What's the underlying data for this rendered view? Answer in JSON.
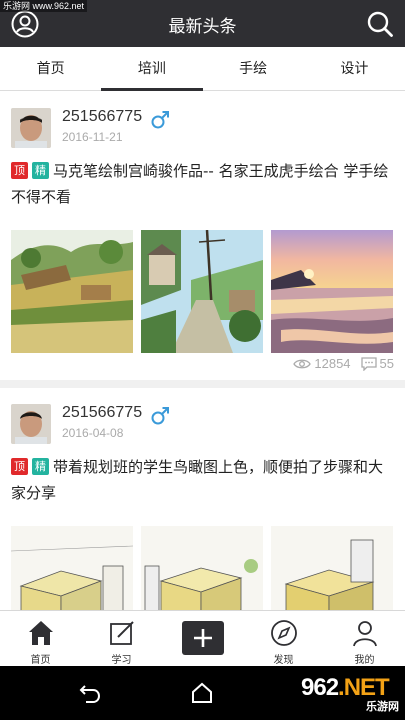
{
  "watermark": "乐游网 www.962.net",
  "header": {
    "title": "最新头条",
    "user_icon": "user-circle-icon",
    "search_icon": "search-icon"
  },
  "tabs": [
    {
      "label": "首页",
      "active": false
    },
    {
      "label": "培训",
      "active": true
    },
    {
      "label": "手绘",
      "active": false
    },
    {
      "label": "设计",
      "active": false
    }
  ],
  "posts": [
    {
      "username": "251566775",
      "date": "2016-11-21",
      "gender": "male",
      "badge_top": "顶",
      "badge_jing": "精",
      "title": "马克笔绘制宫崎骏作品-- 名家王成虎手绘合 学手绘不得不看",
      "views": "12854",
      "comments": "55"
    },
    {
      "username": "251566775",
      "date": "2016-04-08",
      "gender": "male",
      "badge_top": "顶",
      "badge_jing": "精",
      "title": "带着规划班的学生鸟瞰图上色，顺便拍了步骤和大家分享"
    }
  ],
  "tabbar": [
    {
      "label": "首页",
      "icon": "home-icon"
    },
    {
      "label": "学习",
      "icon": "edit-icon"
    },
    {
      "label": "",
      "icon": "plus-icon"
    },
    {
      "label": "发现",
      "icon": "compass-icon"
    },
    {
      "label": "我的",
      "icon": "person-icon"
    }
  ],
  "nav": {
    "logo_text": "962",
    "logo_net": ".NET",
    "logo_sub": "乐游网"
  },
  "colors": {
    "header_bg": "#2f2f33",
    "badge_top": "#e0292b",
    "badge_jing": "#23b39f"
  }
}
